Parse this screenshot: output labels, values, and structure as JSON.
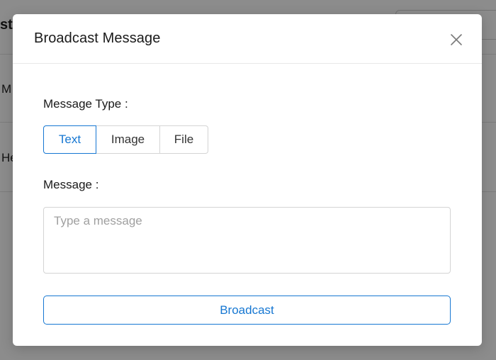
{
  "background": {
    "title_fragment": "st",
    "row_fragments": [
      "M",
      "He"
    ]
  },
  "modal": {
    "title": "Broadcast Message",
    "close_icon": "close-icon",
    "message_type_label": "Message Type :",
    "message_types": [
      {
        "label": "Text",
        "selected": true
      },
      {
        "label": "Image",
        "selected": false
      },
      {
        "label": "File",
        "selected": false
      }
    ],
    "message_label": "Message :",
    "message_value": "",
    "message_placeholder": "Type a message",
    "broadcast_label": "Broadcast"
  },
  "colors": {
    "accent": "#1677d2",
    "overlay": "rgba(0,0,0,0.45)"
  }
}
